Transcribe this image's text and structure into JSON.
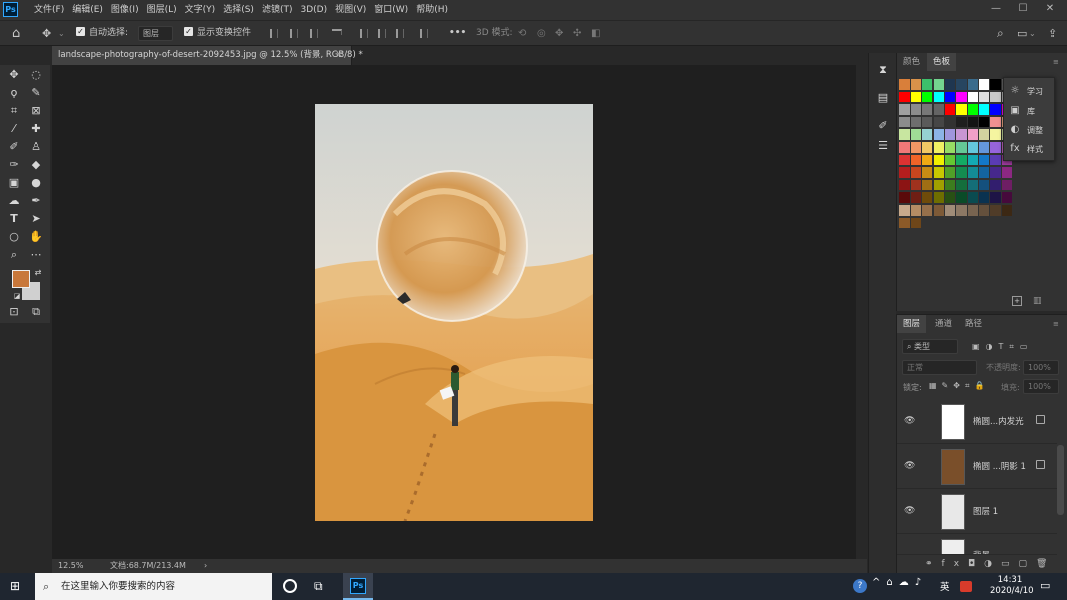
{
  "app": {
    "logo": "Ps"
  },
  "menu": [
    "文件(F)",
    "编辑(E)",
    "图像(I)",
    "图层(L)",
    "文字(Y)",
    "选择(S)",
    "滤镜(T)",
    "3D(D)",
    "视图(V)",
    "窗口(W)",
    "帮助(H)"
  ],
  "window_controls": {
    "minimize": "—",
    "maximize": "☐",
    "close": "✕"
  },
  "options": {
    "auto_select_label": "自动选择:",
    "auto_select_value": "图层",
    "show_transform_label": "显示变换控件",
    "mode_3d_label": "3D 模式:",
    "more": "•••"
  },
  "document": {
    "tab_title": "landscape-photography-of-desert-2092453.jpg @ 12.5% (背景, RGB/8) *",
    "close": "×"
  },
  "status": {
    "zoom": "12.5%",
    "doc_info": "文档:68.7M/213.4M",
    "arrow": "›"
  },
  "swatches_panel": {
    "tabs": [
      "颜色",
      "色板"
    ],
    "active_tab": "色板",
    "rows": [
      [
        "#d97f3a",
        "#d9924a",
        "#3cc06b",
        "#74d48f",
        "#1f3650",
        "#274560",
        "#3a6b8c",
        "#ffffff",
        "#000000",
        "#6a6a6a"
      ],
      [
        "#ff0000",
        "#ffff00",
        "#00ff00",
        "#00ffff",
        "#0000ff",
        "#ff00ff",
        "#ffffff",
        "#e0e0e0",
        "#c8c8c8",
        "#b4b4b4"
      ],
      [
        "#a0a0a0",
        "#8c8c8c",
        "#787878",
        "#646464",
        "#ff0000",
        "#ffff00",
        "#00ff00",
        "#00ffff",
        "#0000ff",
        "#ff00ff"
      ],
      [
        "#8c8c8c",
        "#6e6e6e",
        "#5a5a5a",
        "#464646",
        "#323232",
        "#1e1e1e",
        "#141414",
        "#000000",
        "#f09090",
        "#f8b088"
      ],
      [
        "#c8e6a0",
        "#a0dc96",
        "#96d2d2",
        "#8cb4e6",
        "#a096dc",
        "#c896d2",
        "#f0a0c8",
        "#d2d2a0",
        "#f5f5a0",
        "#c8dca0"
      ],
      [
        "#f07878",
        "#f09664",
        "#f0c864",
        "#f0f064",
        "#96dc64",
        "#64c896",
        "#64c8dc",
        "#6496dc",
        "#9664dc",
        "#c864c8"
      ],
      [
        "#dc3232",
        "#f06428",
        "#f0aa14",
        "#f0f000",
        "#64c832",
        "#14aa64",
        "#14aab4",
        "#1478c8",
        "#5a3cb4",
        "#a03ca0"
      ],
      [
        "#b41e1e",
        "#c8461e",
        "#c88c14",
        "#c8c800",
        "#50a028",
        "#148c50",
        "#148c96",
        "#1464a0",
        "#46288c",
        "#8c2882"
      ],
      [
        "#8c1414",
        "#a0321e",
        "#a06e14",
        "#a0a000",
        "#3c7d1e",
        "#146e3c",
        "#146e78",
        "#14507d",
        "#321e6e",
        "#6e1e64"
      ],
      [
        "#5a0a0a",
        "#6e1e14",
        "#6e4b0a",
        "#6e6e00",
        "#285014",
        "#0a4b28",
        "#0a4b50",
        "#0a3250",
        "#1e1446",
        "#460a3c"
      ],
      [
        "#c8aa8c",
        "#b48c64",
        "#96704b",
        "#7d5a37",
        "#a08c78",
        "#8c7864",
        "#786450",
        "#64503c",
        "#503c28",
        "#3c2814"
      ],
      [
        "#8c5a28",
        "#6e4619"
      ]
    ]
  },
  "learn_popup": {
    "items": [
      {
        "label": "学习",
        "icon": "lightbulb-icon"
      },
      {
        "label": "库",
        "icon": "library-icon"
      },
      {
        "label": "调整",
        "icon": "adjustments-icon"
      },
      {
        "label": "样式",
        "icon": "styles-icon"
      }
    ]
  },
  "layers_panel": {
    "tabs": [
      "图层",
      "通道",
      "路径"
    ],
    "active_tab": "图层",
    "filter_label": "类型",
    "blend_mode": "正常",
    "opacity_label": "不透明度:",
    "opacity_value": "100%",
    "lock_label": "锁定:",
    "fill_label": "填充:",
    "fill_value": "100%",
    "layers": [
      {
        "name": "椭圆...内发光"
      },
      {
        "name": "椭圆 ...阴影 1"
      },
      {
        "name": "图层 1"
      },
      {
        "name": "背景"
      }
    ]
  },
  "taskbar": {
    "search_placeholder": "在这里输入你要搜索的内容",
    "ime": "英",
    "time": "14:31",
    "date": "2020/4/10",
    "ps_label": "Ps"
  },
  "colors": {
    "foreground": "#c8773a",
    "background": "#d0d0d0",
    "ps_blue": "#31a8ff"
  }
}
